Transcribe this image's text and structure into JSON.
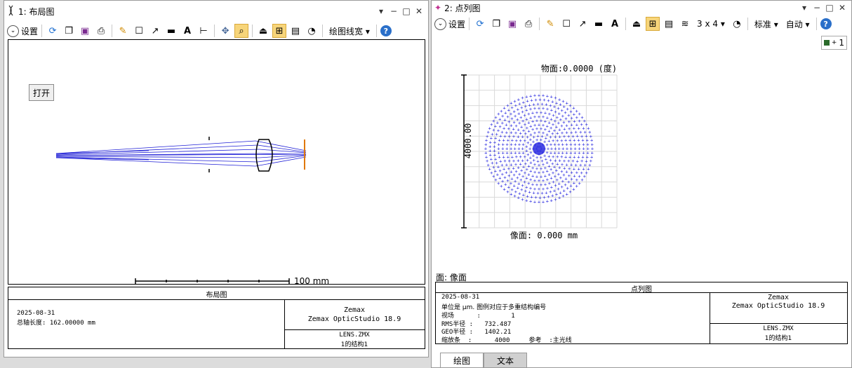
{
  "w1": {
    "title": "1: 布局图",
    "toolbar": {
      "settings": "设置",
      "line_width": "绘图线宽"
    },
    "open_btn": "打开",
    "scale_label": "100 mm",
    "frame": {
      "heading": "布局图",
      "date": "2025-08-31",
      "total_length_label": "总轴长度:",
      "total_length_value": "162.00000 mm",
      "company": "Zemax",
      "product": "Zemax OpticStudio 18.9",
      "file": "LENS.ZMX",
      "config": "1的结构1"
    }
  },
  "w2": {
    "title": "2: 点列图",
    "toolbar": {
      "settings": "设置",
      "layout": "3 x 4",
      "standard": "标准",
      "auto": "自动"
    },
    "badge": "1",
    "object_label": "物面:0.0000 (度)",
    "ylabel": "4000.00",
    "image_label": "像面: 0.000 mm",
    "surface_label": "面: 像面",
    "frame": {
      "heading": "点列图",
      "date": "2025-08-31",
      "unit_line": "单位是 μm. 图例对应于多重结构编号",
      "field_line": "视场      :        1",
      "rms_line": "RMS半径 :   732.487",
      "geo_line": "GEO半径 :   1402.21",
      "scale_line": "缩放条  :      4000     参考  :主光线",
      "company": "Zemax",
      "product": "Zemax OpticStudio 18.9",
      "file": "LENS.ZMX",
      "config": "1的结构1"
    },
    "tabs": [
      "绘图",
      "文本"
    ]
  },
  "colors": {
    "ray": "#1f1fd6",
    "image_plane": "#e07800",
    "spot": "#2a2ae0",
    "grid": "#d9d9d9"
  },
  "chart_data": {
    "type": "scatter",
    "title": "物面:0.0000 (度)",
    "xlabel": "像面: 0.000 mm",
    "ylabel": "4000.00",
    "rms_radius_um": 732.487,
    "geo_radius_um": 1402.21,
    "scale_bar_um": 4000,
    "grid": true
  }
}
